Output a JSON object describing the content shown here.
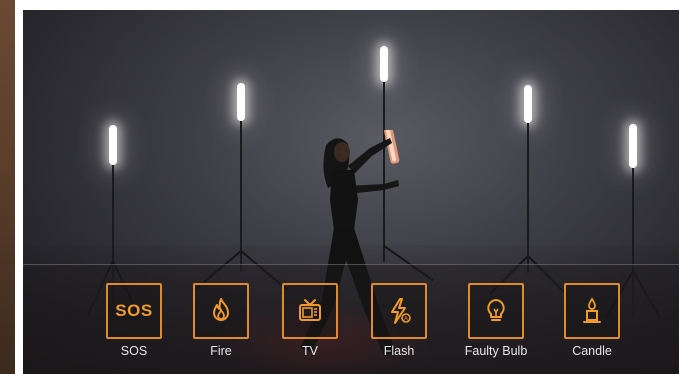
{
  "modes": [
    {
      "label": "SOS",
      "icon": "sos-text-icon",
      "icon_text": "SOS"
    },
    {
      "label": "Fire",
      "icon": "fire-icon"
    },
    {
      "label": "TV",
      "icon": "tv-icon"
    },
    {
      "label": "Flash",
      "icon": "flash-icon"
    },
    {
      "label": "Faulty Bulb",
      "icon": "bulb-icon"
    },
    {
      "label": "Candle",
      "icon": "candle-icon"
    }
  ],
  "colors": {
    "accent": "#e08a2e",
    "label": "#e6e6e6",
    "backdrop": "#3e3e45"
  }
}
